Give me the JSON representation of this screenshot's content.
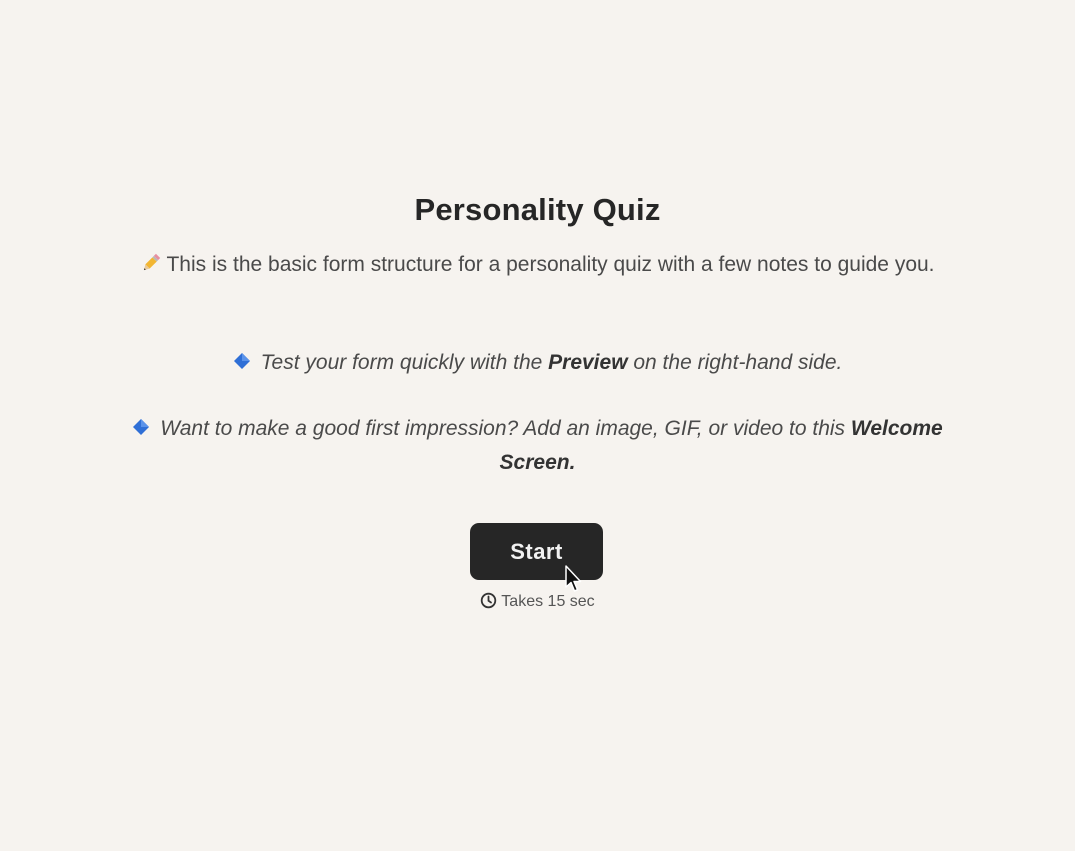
{
  "welcome": {
    "title": "Personality Quiz",
    "intro_icon": "pencil-icon",
    "intro_text": "This is the basic form structure for a personality quiz with a few notes to guide you.",
    "note_icon": "blue-diamond-icon",
    "note1": {
      "before": "Test your form quickly with the ",
      "bold": "Preview",
      "after": " on the right-hand side."
    },
    "note2": {
      "before": "Want to make a good first impression? Add an image, GIF, or video to this ",
      "bold": "Welcome Screen."
    },
    "start_label": "Start",
    "time_icon": "clock-icon",
    "time_text": "Takes 15 sec"
  },
  "colors": {
    "background": "#f6f3ef",
    "button": "#262626",
    "button_text": "#f2f2f2",
    "diamond": "#2f6fd6"
  }
}
